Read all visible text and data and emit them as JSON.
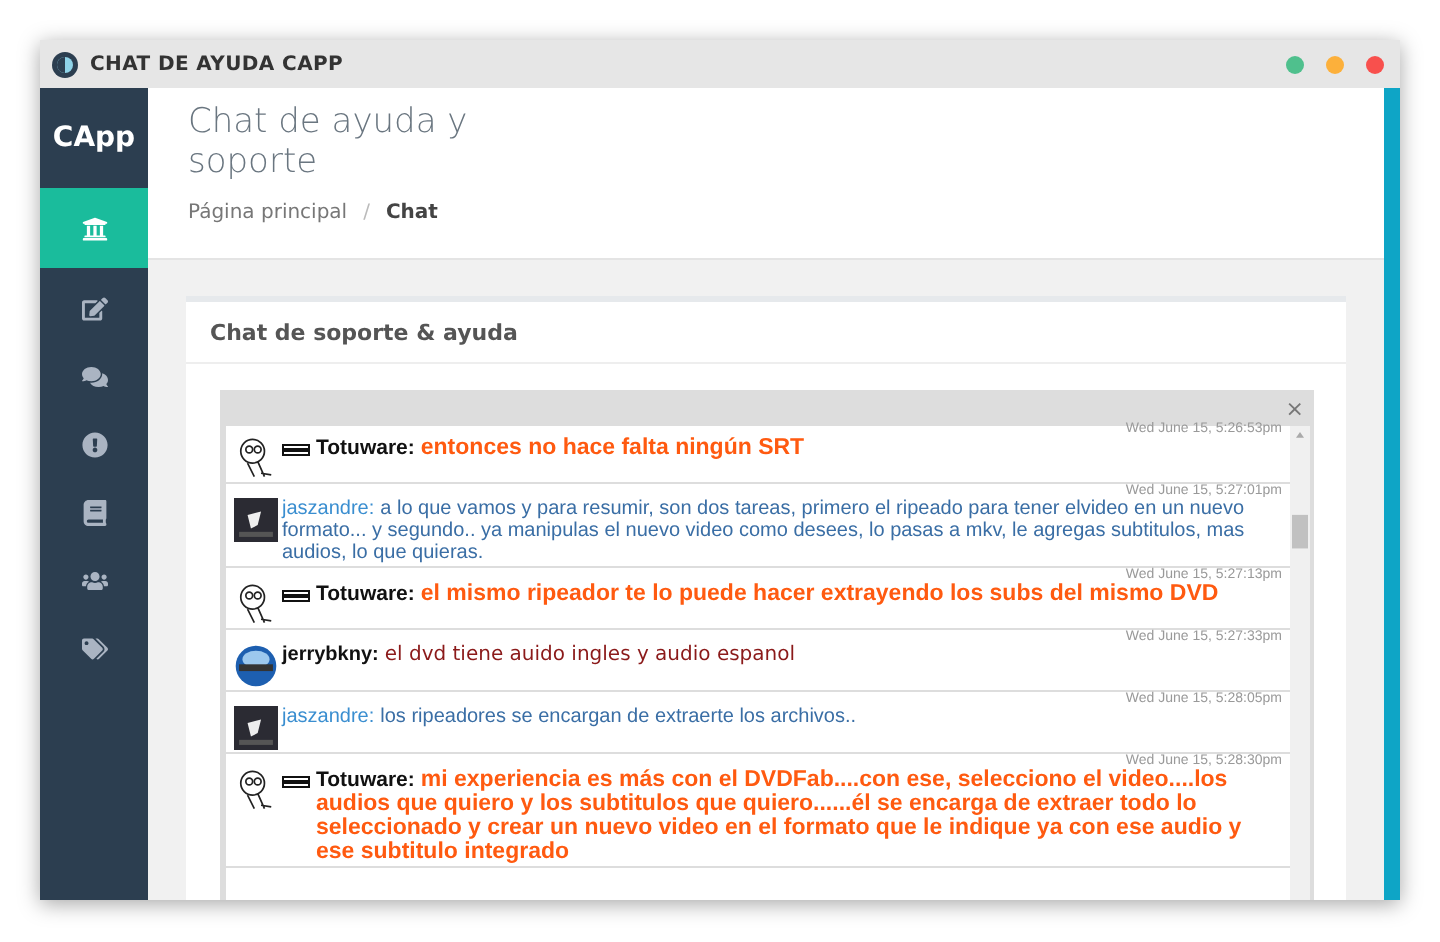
{
  "window": {
    "title": "CHAT DE AYUDA CAPP"
  },
  "sidebar": {
    "brand": "CApp",
    "items": [
      {
        "selected": true
      },
      {
        "selected": false
      },
      {
        "selected": false
      },
      {
        "selected": false
      },
      {
        "selected": false
      },
      {
        "selected": false
      },
      {
        "selected": false
      }
    ]
  },
  "header": {
    "title": "Chat de ayuda y soporte",
    "breadcrumb": [
      {
        "label": "Página principal",
        "selected": false
      },
      {
        "label": "Chat",
        "selected": true
      }
    ],
    "separator": "/"
  },
  "card": {
    "title": "Chat de soporte & ayuda",
    "close": "×"
  },
  "messages": [
    {
      "kind": "staff",
      "name": "Totuware:",
      "text": "entonces no hace falta ningún SRT",
      "time": "Wed June 15, 5:26:53pm"
    },
    {
      "kind": "user",
      "name": "jaszandre:",
      "text": "a lo que vamos y para resumir, son dos tareas, primero el ripeado para tener elvideo en un nuevo formato... y segundo.. ya manipulas el nuevo video como desees, lo pasas a mkv, le agregas subtitulos, mas audios, lo que quieras.",
      "time": "Wed June 15, 5:27:01pm"
    },
    {
      "kind": "staff",
      "name": "Totuware:",
      "text": "el mismo ripeador te lo puede hacer extrayendo los subs del mismo DVD",
      "time": "Wed June 15, 5:27:13pm"
    },
    {
      "kind": "script",
      "name": "jerrybkny:",
      "text": "el dvd tiene auido ingles y audio espanol",
      "time": "Wed June 15, 5:27:33pm"
    },
    {
      "kind": "user",
      "name": "jaszandre:",
      "text": "los ripeadores se encargan de extraerte los archivos..",
      "time": "Wed June 15, 5:28:05pm"
    },
    {
      "kind": "staff",
      "name": "Totuware:",
      "text": "mi experiencia es más con el DVDFab....con ese, selecciono el video....los audios que quiero y los subtitulos que quiero......él se encarga de extraer todo lo seleccionado y crear un nuevo video en el formato que le indique ya con ese audio y ese subtitulo integrado",
      "time": "Wed June 15, 5:28:30pm"
    }
  ]
}
